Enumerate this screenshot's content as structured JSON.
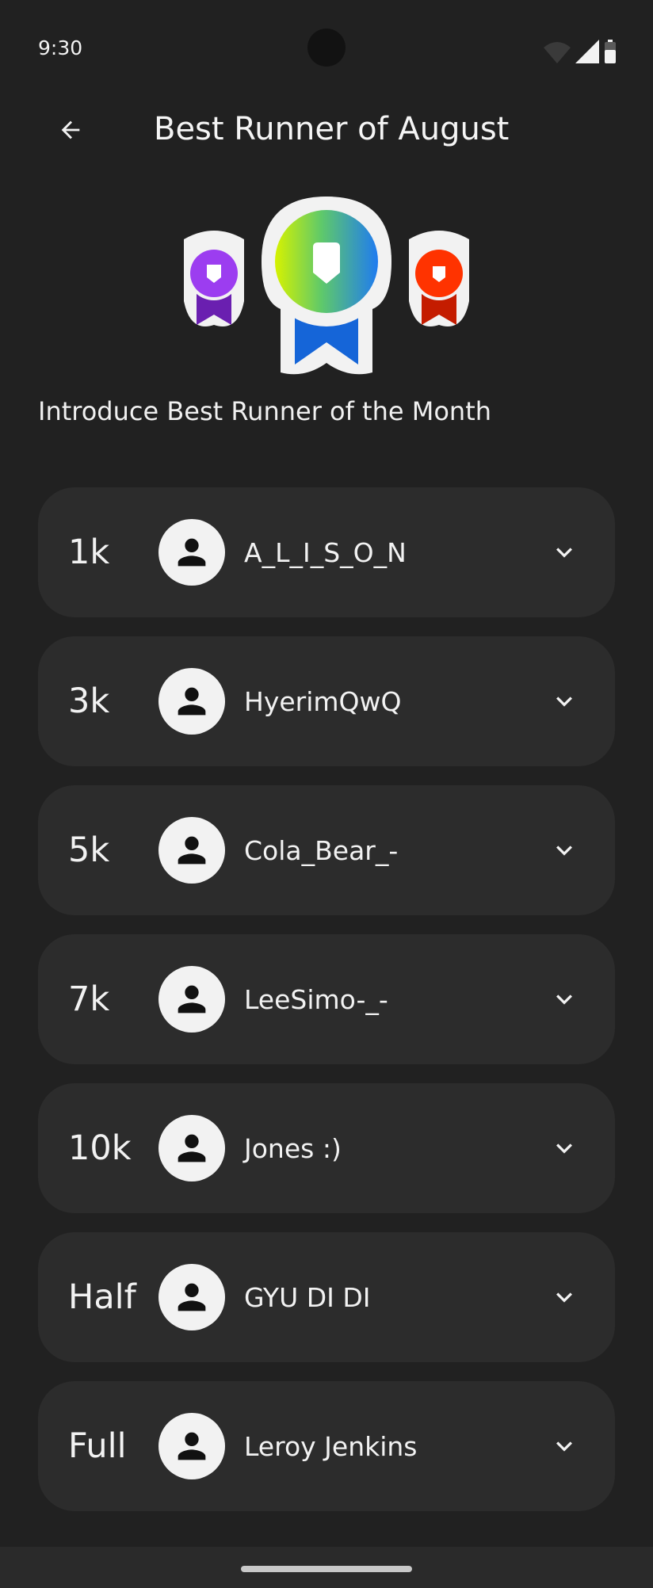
{
  "status_bar": {
    "time": "9:30",
    "icons": [
      "wifi-icon",
      "signal-icon",
      "battery-icon"
    ]
  },
  "header": {
    "back_icon": "arrow-left-icon",
    "title": "Best Runner of August"
  },
  "medals": [
    "purple-medal-icon",
    "gradient-medal-icon",
    "red-medal-icon"
  ],
  "subtitle": "Introduce Best Runner of the Month",
  "runners": [
    {
      "distance": "1k",
      "name": "A_L_I_S_O_N"
    },
    {
      "distance": "3k",
      "name": "HyerimQwQ"
    },
    {
      "distance": "5k",
      "name": "Cola_Bear_-"
    },
    {
      "distance": "7k",
      "name": "LeeSimo-_-"
    },
    {
      "distance": "10k",
      "name": "Jones :)"
    },
    {
      "distance": "Half",
      "name": "GYU DI DI"
    },
    {
      "distance": "Full",
      "name": "Leroy Jenkins"
    }
  ],
  "colors": {
    "background": "#212121",
    "card": "#2c2c2c",
    "accent_blue": "#1565d8",
    "purple": "#9c3df0",
    "red": "#ff3300"
  }
}
